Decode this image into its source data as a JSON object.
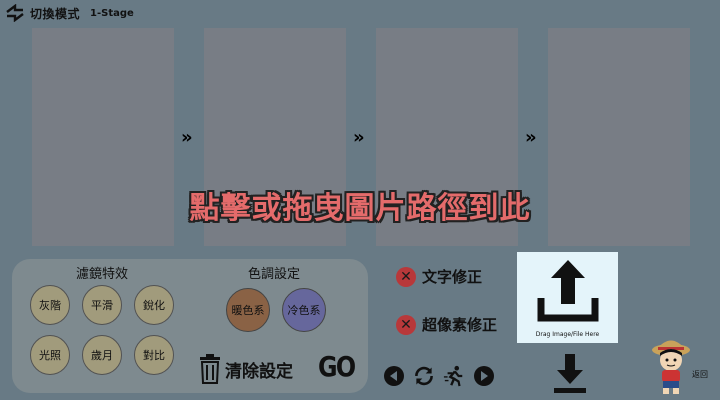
{
  "header": {
    "mode_label": "切換模式",
    "stage_label": "1-Stage",
    "switch_icon": "switch-arrows-icon"
  },
  "panels": {
    "count": 4,
    "arrow_glyph": "»"
  },
  "drop_prompt": "點擊或拖曳圖片路徑到此",
  "filters": {
    "title": "濾鏡特效",
    "items": [
      "灰階",
      "平滑",
      "銳化",
      "光照",
      "歲月",
      "對比"
    ]
  },
  "color_settings": {
    "title": "色調設定",
    "warm_label": "暖色系",
    "cool_label": "冷色系",
    "warm_color": "#8a6245",
    "cool_color": "#66679c"
  },
  "actions": {
    "clear_label": "清除設定",
    "go_label": "GO",
    "clear_icon": "trash-icon"
  },
  "corrections": {
    "text_fix_label": "文字修正",
    "super_res_label": "超像素修正",
    "status_icon": "x-circle-icon"
  },
  "media": {
    "icons": [
      "prev-icon",
      "refresh-icon",
      "run-icon",
      "next-icon"
    ]
  },
  "upload": {
    "caption": "Drag Image/File Here",
    "icon": "upload-icon"
  },
  "download": {
    "icon": "download-icon"
  },
  "back": {
    "label": "返回",
    "icon": "chibi-character-icon"
  },
  "colors": {
    "background": "#687a85",
    "panel": "#787d85",
    "prompt": "#e46b6b",
    "upload_bg": "#e4f4fa"
  }
}
